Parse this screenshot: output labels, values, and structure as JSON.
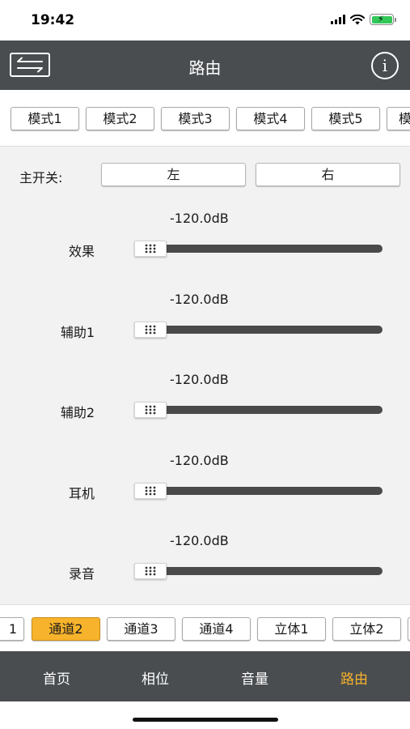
{
  "status_bar": {
    "time": "19:42"
  },
  "header": {
    "title": "路由"
  },
  "modes": [
    "模式1",
    "模式2",
    "模式3",
    "模式4",
    "模式5",
    "模"
  ],
  "master": {
    "label": "主开关:",
    "left": "左",
    "right": "右"
  },
  "sliders": [
    {
      "label": "效果",
      "value": "-120.0dB",
      "level": 0
    },
    {
      "label": "辅助1",
      "value": "-120.0dB",
      "level": 0
    },
    {
      "label": "辅助2",
      "value": "-120.0dB",
      "level": 0
    },
    {
      "label": "耳机",
      "value": "-120.0dB",
      "level": 0
    },
    {
      "label": "录音",
      "value": "-120.0dB",
      "level": 0
    }
  ],
  "channels": [
    {
      "label": "1",
      "active": false
    },
    {
      "label": "通道2",
      "active": true
    },
    {
      "label": "通道3",
      "active": false
    },
    {
      "label": "通道4",
      "active": false
    },
    {
      "label": "立体1",
      "active": false
    },
    {
      "label": "立体2",
      "active": false
    },
    {
      "label": "",
      "active": false
    }
  ],
  "tabs": [
    {
      "label": "首页",
      "active": false
    },
    {
      "label": "相位",
      "active": false
    },
    {
      "label": "音量",
      "active": false
    },
    {
      "label": "路由",
      "active": true
    }
  ],
  "colors": {
    "accent": "#f7b32b",
    "bar": "#494d50"
  }
}
